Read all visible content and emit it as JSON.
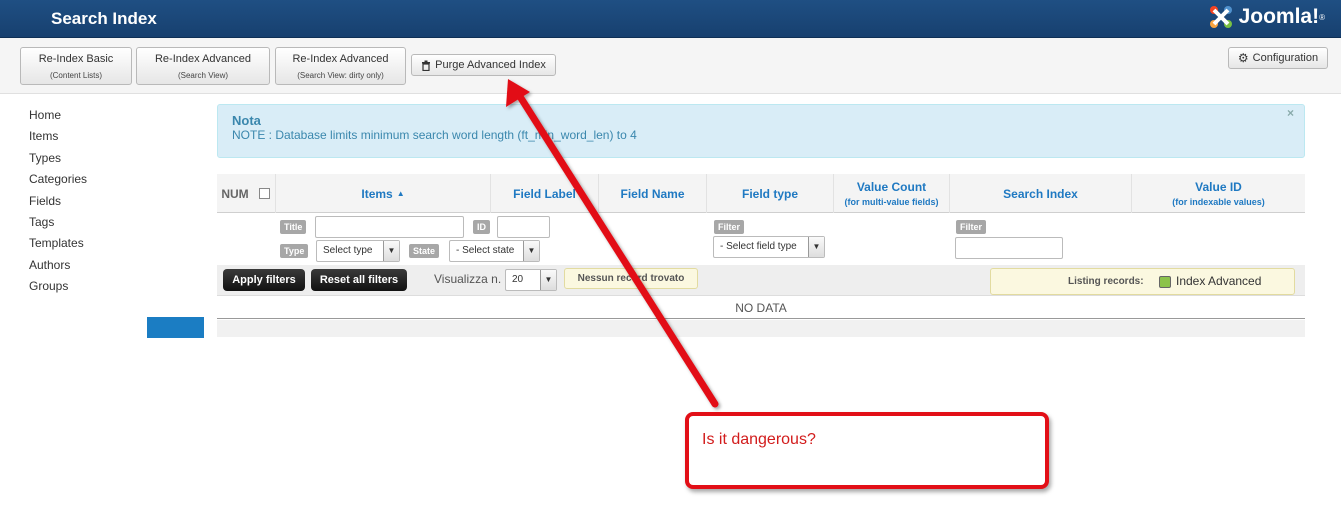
{
  "header": {
    "title": "Search Index",
    "brand": "Joomla!",
    "brand_reg": "®"
  },
  "toolbar": {
    "reindex_basic": {
      "label": "Re-Index Basic",
      "sub": "(Content Lists)"
    },
    "reindex_adv": {
      "label": "Re-Index Advanced",
      "sub": "(Search View)"
    },
    "reindex_adv_dirty": {
      "label": "Re-Index Advanced",
      "sub": "(Search View: dirty only)"
    },
    "purge": "Purge Advanced Index",
    "configuration": "Configuration"
  },
  "sidebar": [
    "Home",
    "Items",
    "Types",
    "Categories",
    "Fields",
    "Tags",
    "Templates",
    "Authors",
    "Groups"
  ],
  "alert": {
    "title": "Nota",
    "message": "NOTE : Database limits minimum search word length (ft_min_word_len) to 4",
    "close": "×"
  },
  "table": {
    "num": "NUM",
    "items": "Items",
    "sort": "▲",
    "field_label": "Field Label",
    "field_name": "Field Name",
    "field_type": "Field type",
    "value_count": "Value Count",
    "value_count_sub": "(for multi-value fields)",
    "search_index": "Search Index",
    "value_id": "Value ID",
    "value_id_sub": "(for indexable values)",
    "no_data": "NO DATA"
  },
  "filters": {
    "title_label": "Title",
    "id_label": "ID",
    "type_label": "Type",
    "type_value": "Select type",
    "state_label": "State",
    "state_value": "- Select state",
    "filter_label": "Filter",
    "field_type_value": "- Select field type",
    "filter2_label": "Filter"
  },
  "actions": {
    "apply": "Apply filters",
    "reset": "Reset all filters",
    "show_label": "Visualizza n.",
    "show_value": "20",
    "no_records": "Nessun record trovato",
    "listing_label": "Listing records:",
    "listing_value": "Index Advanced"
  },
  "annotation": {
    "text": "Is it dangerous?"
  },
  "colors": {
    "header": "#1f4f83",
    "accent": "#1f79c2",
    "annotation": "#e20f17",
    "alert_bg": "#d9edf7"
  }
}
